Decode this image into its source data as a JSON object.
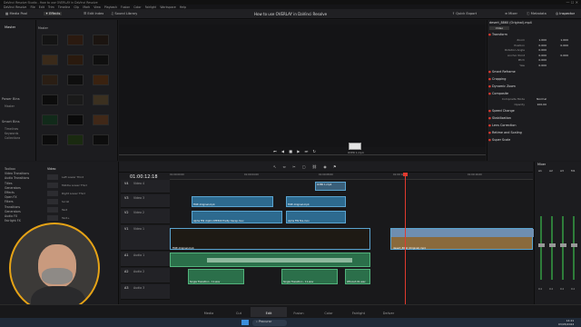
{
  "window": {
    "title": "DaVinci Resolve Studio - How to use OVERLAY in DaVinci Resolve"
  },
  "menu": [
    "DaVinci Resolve",
    "File",
    "Edit",
    "Trim",
    "Timeline",
    "Clip",
    "Mark",
    "View",
    "Playback",
    "Fusion",
    "Color",
    "Fairlight",
    "Workspace",
    "Help"
  ],
  "toolbar": {
    "media_pool": "Media Pool",
    "effects": "Effects",
    "edit_index": "Edit Index",
    "sound_library": "Sound Library",
    "project_title": "How to use OVERLAY in DaVinci Resolve",
    "quick_export": "Quick Export",
    "mixer": "Mixer",
    "metadata": "Metadata",
    "inspector": "Inspector"
  },
  "media_pool": {
    "master_label": "Master",
    "power_bins_label": "Power Bins",
    "master_sub": "Master",
    "smart_bins_label": "Smart Bins",
    "smart_bins": [
      "Timelines",
      "Keywords",
      "Collections"
    ],
    "thumbs": [
      "Clip 1",
      "Clip 2",
      "Clip 3",
      "Clip 4",
      "Clip 5",
      "Clip 6",
      "Clip 7",
      "Clip 8",
      "Clip 9",
      "Clip 10",
      "Clip 11",
      "Clip 12",
      "Clip 13",
      "Clip 14",
      "Clip 15",
      "Clip 16",
      "Clip 17",
      "Clip 18"
    ]
  },
  "inspector": {
    "clip_name": "desert_8860 (Original).mp4",
    "sections": [
      {
        "name": "Transform",
        "fields": [
          {
            "label": "Zoom",
            "x": "1.000",
            "y": "1.000"
          },
          {
            "label": "Position",
            "x": "0.000",
            "y": "0.000"
          },
          {
            "label": "Rotation Angle",
            "x": "0.000",
            "y": ""
          },
          {
            "label": "Anchor Point",
            "x": "0.000",
            "y": "0.000"
          },
          {
            "label": "Pitch",
            "x": "0.000",
            "y": ""
          },
          {
            "label": "Yaw",
            "x": "0.000",
            "y": ""
          }
        ]
      },
      {
        "name": "Smart Reframe"
      },
      {
        "name": "Cropping"
      },
      {
        "name": "Dynamic Zoom"
      },
      {
        "name": "Composite",
        "fields": [
          {
            "label": "Composite Mode",
            "x": "Normal",
            "y": ""
          },
          {
            "label": "Opacity",
            "x": "100.00",
            "y": ""
          }
        ]
      },
      {
        "name": "Speed Change"
      },
      {
        "name": "Stabilization"
      },
      {
        "name": "Lens Correction"
      },
      {
        "name": "Retime and Scaling"
      },
      {
        "name": "Super Scale"
      }
    ]
  },
  "effects_panel": {
    "items": [
      "Toolbox",
      "Video Transitions",
      "Audio Transitions",
      "Titles",
      "Generators",
      "Effects",
      "Open FX",
      "Filters",
      "Transitions",
      "Generators",
      "Audio FX",
      "Fairlight FX"
    ],
    "list_header": "Video",
    "list": [
      "Left Lower Third",
      "Middle Lower Third",
      "Right Lower Third",
      "Scroll",
      "Text",
      "Text+"
    ]
  },
  "timeline": {
    "timecode": "01:00:12:18",
    "tracks": [
      {
        "id": "V4",
        "name": "Video 4"
      },
      {
        "id": "V3",
        "name": "Video 3"
      },
      {
        "id": "V2",
        "name": "Video 2"
      },
      {
        "id": "V1",
        "name": "Video 1"
      },
      {
        "id": "A1",
        "name": "Audio 1"
      },
      {
        "id": "A2",
        "name": "Audio 2"
      },
      {
        "id": "A3",
        "name": "Audio 3"
      }
    ],
    "ruler": [
      "01:00:00:00",
      "01:00:04:00",
      "01:00:08:00",
      "01:00:12:00",
      "01:00:16:00",
      "01:00:20:00"
    ],
    "clips_v4": [
      "OVER 1.mp4"
    ],
    "clips_v3": [
      "FIRE-Original.mp4",
      "FIRE-Original.mp4"
    ],
    "clips_v2": [
      "alpha FIN clip01 dlfE300 fire5p transp.mov",
      "alpha FIN fire.mov"
    ],
    "clips_v1": [
      "FIRE-Original.mp4",
      "desert_8860 (Original).mp4"
    ],
    "clips_a2": [
      "Single Transition - 11.wav",
      "Single Transition - 11.wav",
      "Whoosh 01.wav"
    ]
  },
  "mixer": {
    "label": "Mixer",
    "channels": [
      "A1",
      "A2",
      "A3",
      "M1"
    ],
    "values": [
      "0.0",
      "0.0",
      "0.0",
      "0.0"
    ]
  },
  "pages": [
    "Media",
    "Cut",
    "Edit",
    "Fusion",
    "Color",
    "Fairlight",
    "Deliver"
  ],
  "taskbar": {
    "search": "Procurar",
    "time": "14:21",
    "date": "03/05/2024"
  },
  "viewer": {
    "clip_label": "OVER 1.mp4"
  }
}
